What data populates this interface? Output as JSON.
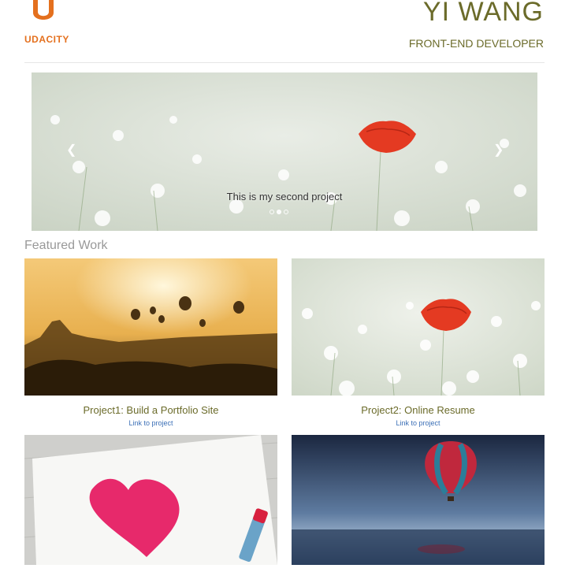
{
  "header": {
    "logo_text": "UDACITY",
    "name": "YI WANG",
    "role": "FRONT-END DEVELOPER"
  },
  "carousel": {
    "caption": "This is my second project",
    "prev_icon": "chevron-left-icon",
    "next_icon": "chevron-right-icon",
    "slides_count": 3,
    "active_slide": 2
  },
  "featured": {
    "title": "Featured Work",
    "projects": [
      {
        "title": "Project1: Build a Portfolio Site",
        "link": "Link to project",
        "image": "hot-air-balloons-over-temples"
      },
      {
        "title": "Project2: Online Resume",
        "link": "Link to project",
        "image": "red-poppy-in-white-flowers"
      },
      {
        "title": "",
        "link": "",
        "image": "pink-crayon-heart"
      },
      {
        "title": "",
        "link": "",
        "image": "balloon-over-water-at-night"
      }
    ]
  },
  "colors": {
    "brand_orange": "#e4701e",
    "title_olive": "#6b6b2a",
    "link_blue": "#3b6fb6"
  }
}
